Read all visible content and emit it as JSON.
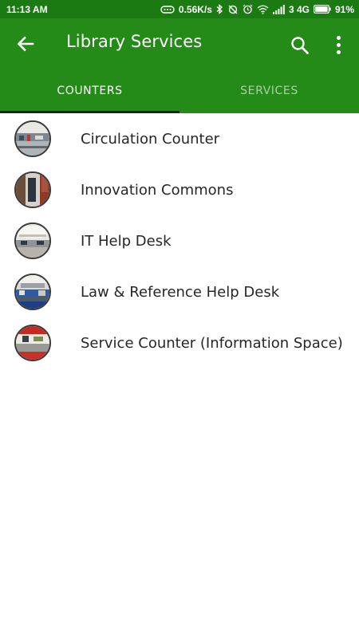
{
  "status_bar": {
    "time": "11:13 AM",
    "speed": "0.56K/s",
    "network": "3 4G",
    "battery": "91%",
    "icons": [
      "chat-bubble-icon",
      "bluetooth-icon",
      "sync-off-icon",
      "alarm-icon",
      "wifi-icon",
      "signal-icon",
      "battery-icon"
    ]
  },
  "app_bar": {
    "title": "Library Services",
    "back_icon": "arrow-back-icon",
    "search_icon": "search-icon",
    "menu_icon": "more-vert-icon"
  },
  "tabs": [
    {
      "label": "COUNTERS",
      "selected": true
    },
    {
      "label": "SERVICES",
      "selected": false
    }
  ],
  "counters": [
    {
      "label": "Circulation Counter"
    },
    {
      "label": "Innovation Commons"
    },
    {
      "label": "IT Help Desk"
    },
    {
      "label": "Law & Reference Help Desk"
    },
    {
      "label": "Service Counter (Information Space)"
    }
  ],
  "colors": {
    "status_bar": "#1b7a12",
    "app_bar": "#248a18",
    "tab_indicator": "#1f1f1f",
    "tab_inactive_text": "#a9d3a4"
  }
}
